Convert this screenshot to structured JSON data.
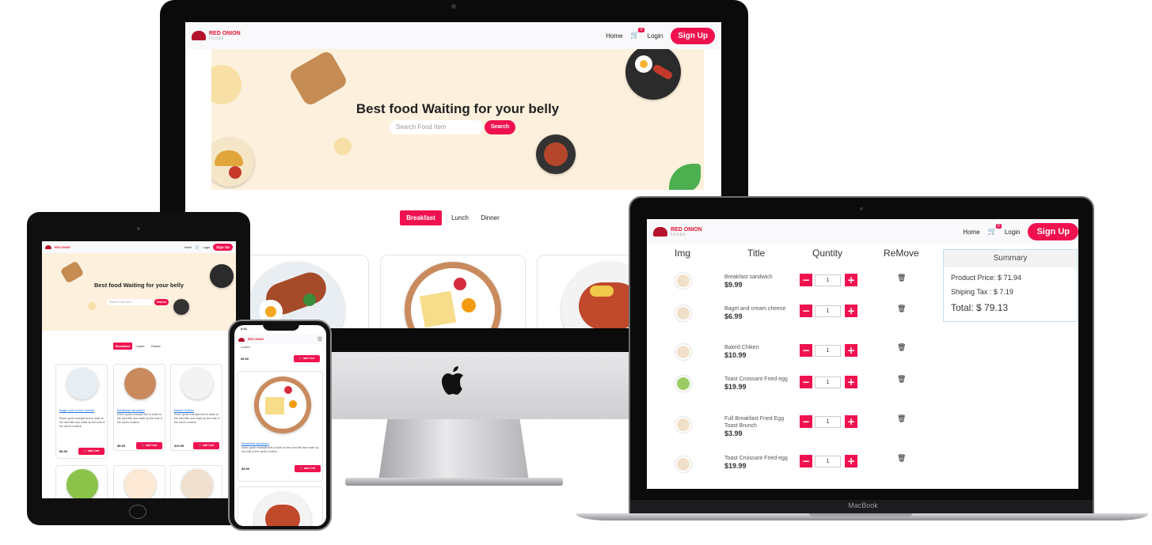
{
  "brand": {
    "name": "RED ONION",
    "sub": "FOODS",
    "accent": "#f0124f",
    "hero_bg": "#fdf1dd"
  },
  "nav": {
    "home": "Home",
    "cart_count": "0",
    "login": "Login",
    "signup": "Sign Up",
    "cart_icon": "cart-icon"
  },
  "hero": {
    "title": "Best food Waiting for your belly",
    "search_placeholder": "Search Food Item",
    "search_button": "Search"
  },
  "tabs": [
    "Breakfast",
    "Lunch",
    "Dinner"
  ],
  "cart_page": {
    "headers": [
      "Img",
      "Title",
      "Quntity",
      "ReMove"
    ],
    "items": [
      {
        "title": "Breakfast sandwich",
        "price": "$9.99",
        "qty": "1"
      },
      {
        "title": "Bagel and cream cheese",
        "price": "$6.99",
        "qty": "1"
      },
      {
        "title": "Baked Chiken",
        "price": "$10.99",
        "qty": "1"
      },
      {
        "title": "Toast Croissant Fried egg",
        "price": "$19.99",
        "qty": "1"
      },
      {
        "title": "Full Breakfast Fried Egg Toast Brunch",
        "price": "$3.99",
        "qty": "1"
      },
      {
        "title": "Toast Croissant Fried egg",
        "price": "$19.99",
        "qty": "1"
      }
    ],
    "summary": {
      "title": "Summary",
      "product_price": "Product Price: $ 71.94",
      "tax": "Shiping Tax : $ 7.19",
      "total": "Total: $ 79.13"
    }
  },
  "tablet_cards": [
    {
      "title": "Bagel and cream cheese",
      "desc": "Some quick example text to build on the card title and make up the bulk of the card's content.",
      "price": "$6.99",
      "button": "add Cart"
    },
    {
      "title": "Breakfast sandwich",
      "desc": "Some quick example text to build on the card title and make up the bulk of the card's content.",
      "price": "$9.99",
      "button": "add Cart"
    },
    {
      "title": "Baked Chiken",
      "desc": "Some quick example text to build on the card title and make up the bulk of the card's content.",
      "price": "$10.99",
      "button": "add Cart"
    }
  ],
  "phone": {
    "time": "9:41",
    "top_text": "content.",
    "top_price": "$9.99",
    "card_title": "Breakfast sandwich",
    "card_desc": "Some quick example text to build on the card title and make up the bulk of the card's content.",
    "card_price": "$9.99",
    "button": "add Cart"
  },
  "macbook_label": "MacBook"
}
